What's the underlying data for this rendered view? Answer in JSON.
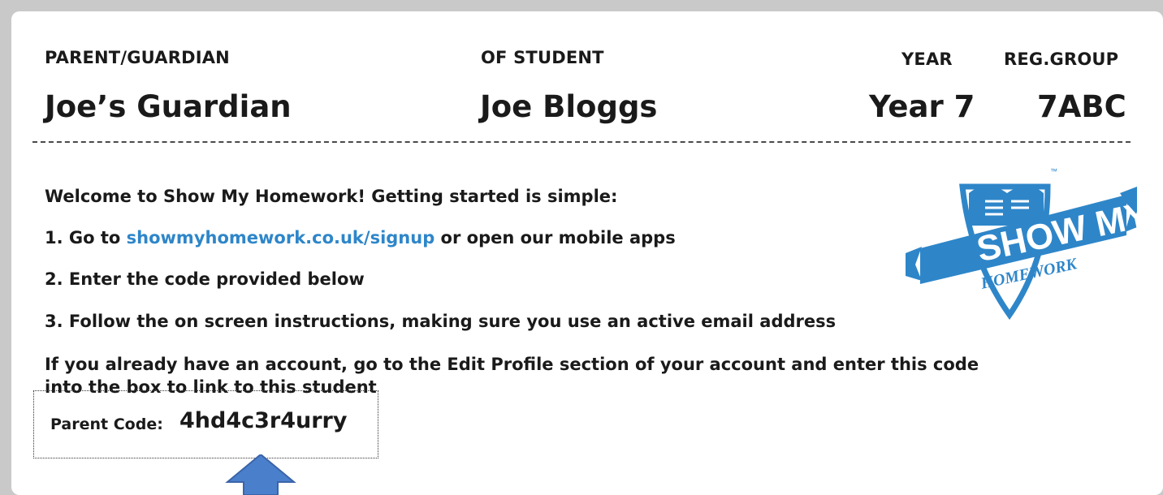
{
  "header": {
    "parent_label": "PARENT/GUARDIAN",
    "student_label": "OF STUDENT",
    "year_label": "YEAR",
    "reg_label": "REG.GROUP",
    "parent_name": "Joe’s Guardian",
    "student_name": "Joe Bloggs",
    "year_value": "Year 7",
    "reg_value": "7ABC"
  },
  "instructions": {
    "welcome": "Welcome to Show My Homework! Getting started is simple:",
    "step1_prefix": "1.  Go to ",
    "step1_link": "showmyhomework.co.uk/signup",
    "step1_suffix": " or open our mobile apps",
    "step2": "2.  Enter the code provided below",
    "step3": "3.  Follow the on screen instructions, making sure you use an active email address",
    "existing_line1": "If you already have an account, go to the Edit Profile section of your account and enter this code",
    "existing_line2": "into the box to link to this student"
  },
  "code": {
    "label": "Parent Code:",
    "value": "4hd4c3r4urry"
  },
  "logo": {
    "line1": "SHOW MY",
    "line2": "HOMEWORK",
    "tm": "™"
  },
  "colors": {
    "brand_blue": "#2e86c9",
    "arrow_blue": "#4a7fcb"
  }
}
